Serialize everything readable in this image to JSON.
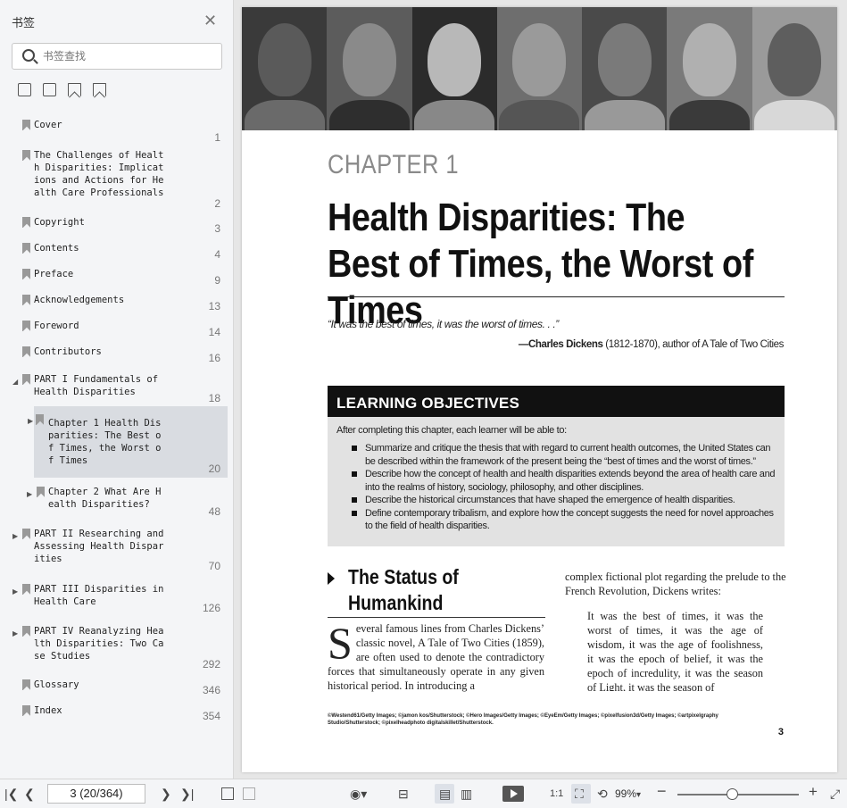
{
  "sidebar": {
    "title": "书签",
    "search_placeholder": "书签查找",
    "items": [
      {
        "label": "Cover",
        "page": "1"
      },
      {
        "label": "The Challenges of Health Disparities: Implications and Actions for Health Care Professionals",
        "page": "2"
      },
      {
        "label": "Copyright",
        "page": "3"
      },
      {
        "label": "Contents",
        "page": "4"
      },
      {
        "label": "Preface",
        "page": "9"
      },
      {
        "label": "Acknowledgements",
        "page": "13"
      },
      {
        "label": "Foreword",
        "page": "14"
      },
      {
        "label": "Contributors",
        "page": "16"
      },
      {
        "label": "PART I Fundamentals of Health Disparities",
        "page": "18"
      },
      {
        "label": "Chapter 1 Health Disparities: The Best of Times, the Worst of Times",
        "page": "20"
      },
      {
        "label": "Chapter 2 What Are Health Disparities?",
        "page": "48"
      },
      {
        "label": "PART II Researching and Assessing Health Disparities",
        "page": "70"
      },
      {
        "label": "PART III Disparities in Health Care",
        "page": "126"
      },
      {
        "label": "PART IV Reanalyzing Health Disparities: Two Case Studies",
        "page": "292"
      },
      {
        "label": "Glossary",
        "page": "346"
      },
      {
        "label": "Index",
        "page": "354"
      }
    ]
  },
  "page": {
    "chapter_label": "CHAPTER 1",
    "chapter_title": "Health Disparities: The Best of Times, the Worst of Times",
    "epigraph": "“It was the best of times, it was the worst of times. . .”",
    "epigraph_author": "—Charles Dickens",
    "epigraph_rest": " (1812-1870), author of A Tale of Two Cities",
    "objectives_heading": "LEARNING OBJECTIVES",
    "objectives_intro": "After completing this chapter, each learner will be able to:",
    "objectives": [
      "Summarize and critique the thesis that with regard to current health outcomes, the United States can be described within the framework of the present being the “best of times and the worst of times.”",
      "Describe how the concept of health and health disparities extends beyond the area of health care and into the realms of history, sociology, philosophy, and other disciplines.",
      "Describe the historical circumstances that have shaped the emergence of health disparities.",
      "Define contemporary tribalism, and explore how the concept suggests the need for novel approaches to the field of health disparities."
    ],
    "section_title": "The Status of Humankind",
    "dropcap": "S",
    "body_left": "everal famous lines from Charles Dickens’ classic novel, A Tale of Two Cities (1859), are often used to denote the contradictory forces that simultaneously operate in any given historical period. In introducing a",
    "body_right": "complex fictional plot regarding the prelude to the French Revolution, Dickens writes:",
    "blockquote": "It was the best of times, it was the worst of times, it was the age of wisdom, it was the age of foolishness, it was the epoch of belief, it was the epoch of incredulity, it was the season of Light, it was the season of",
    "credits": "©Westend61/Getty Images; ©jamon kos/Shutterstock; ©Hero Images/Getty Images; ©EyeEm/Getty Images; ©pixelfusion3d/Getty Images; ©artpixelgraphy Studio/Shutterstock; ©pixelheadphoto digitalskillet/Shutterstock.",
    "page_number": "3"
  },
  "statusbar": {
    "page_indicator": "3 (20/364)",
    "zoom": "99%",
    "zoom_level_fraction": 0.45
  }
}
